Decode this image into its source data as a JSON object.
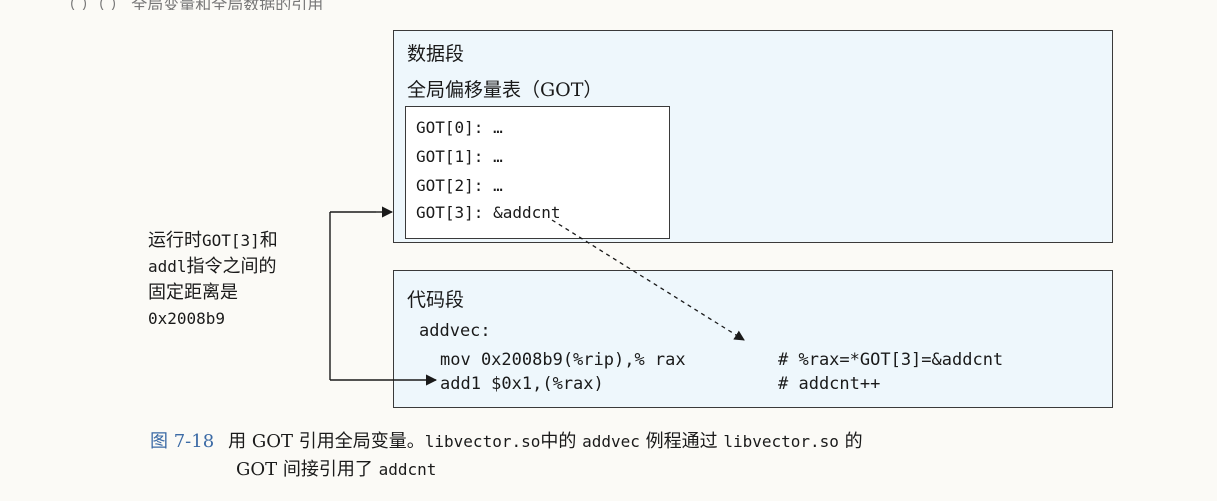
{
  "top_cutoff": "（ ）（ ） 全局变量和全局数据的引用",
  "data_segment": {
    "title": "数据段",
    "got_title": "全局偏移量表（GOT）",
    "entries": [
      "GOT[0]: …",
      "GOT[1]: …",
      "GOT[2]: …",
      "GOT[3]: &addcnt"
    ]
  },
  "code_segment": {
    "title": "代码段",
    "label": "addvec:",
    "instructions": [
      {
        "code": "mov 0x2008b9(%rip),% rax",
        "comment": "# %rax=*GOT[3]=&addcnt"
      },
      {
        "code": "add1 $0x1,(%rax)",
        "comment": "# addcnt++"
      }
    ]
  },
  "annotation": {
    "line1_a": "运行时",
    "line1_b": "GOT[3]",
    "line1_c": "和",
    "line2_a": "addl",
    "line2_b": "指令之间的",
    "line3": "固定距离是",
    "line4": "0x2008b9"
  },
  "caption": {
    "figure_number": "图 7-18",
    "p1": "用 GOT 引用全局变量。",
    "c1": "libvector.so",
    "p2": "中的 ",
    "c2": "addvec",
    "p3": " 例程通过 ",
    "c3": "libvector.so",
    "p4": " 的",
    "p5": "GOT 间接引用了 ",
    "c4": "addcnt"
  }
}
